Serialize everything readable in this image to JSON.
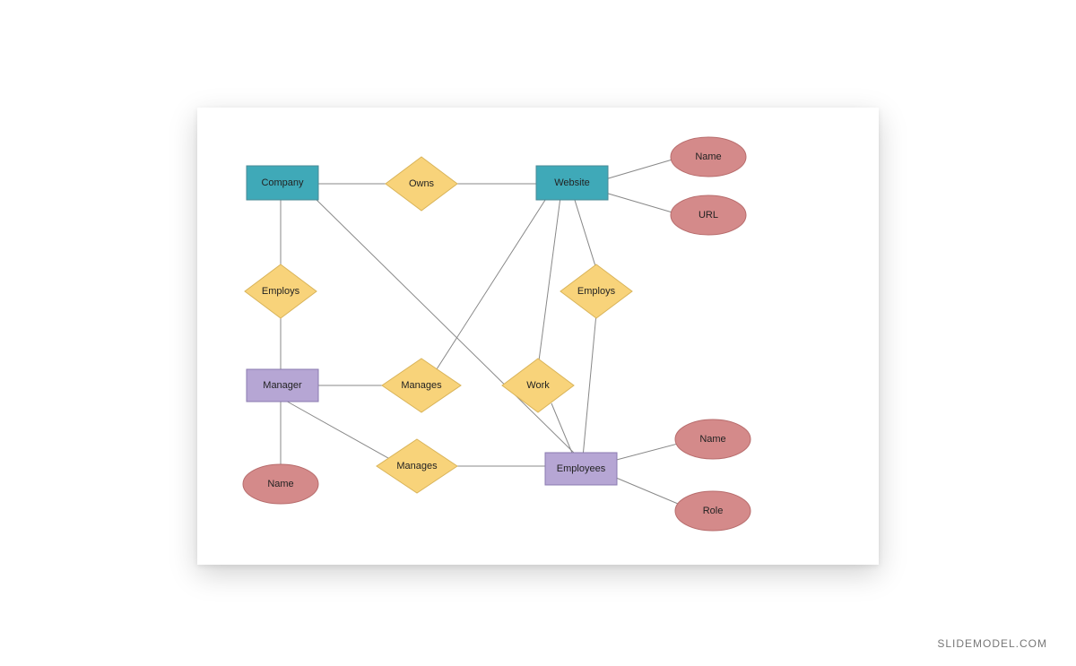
{
  "watermark": "SLIDEMODEL.COM",
  "entities": {
    "company": {
      "label": "Company"
    },
    "website": {
      "label": "Website"
    },
    "manager": {
      "label": "Manager"
    },
    "employees": {
      "label": "Employees"
    }
  },
  "relationships": {
    "owns": {
      "label": "Owns"
    },
    "employs1": {
      "label": "Employs"
    },
    "employs2": {
      "label": "Employs"
    },
    "manages1": {
      "label": "Manages"
    },
    "work": {
      "label": "Work"
    },
    "manages2": {
      "label": "Manages"
    }
  },
  "attributes": {
    "website_name": {
      "label": "Name"
    },
    "website_url": {
      "label": "URL"
    },
    "manager_name": {
      "label": "Name"
    },
    "employees_name": {
      "label": "Name"
    },
    "employees_role": {
      "label": "Role"
    }
  }
}
